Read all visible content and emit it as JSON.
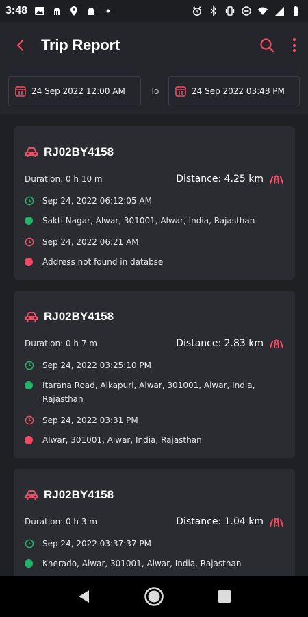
{
  "statusbar": {
    "time": "3:48"
  },
  "header": {
    "title": "Trip Report"
  },
  "filters": {
    "from_date": "24 Sep 2022 12:00 AM",
    "to_label": "To",
    "to_date": "24 Sep 2022 03:48 PM"
  },
  "colors": {
    "accent": "#f04b64",
    "start": "#24b36b",
    "background": "#1e2024",
    "card": "#2a2c31"
  },
  "trips": [
    {
      "vehicle": "RJ02BY4158",
      "duration": "Duration: 0 h 10 m",
      "distance": "Distance: 4.25 km",
      "start_time": "Sep 24, 2022 06:12:05 AM",
      "start_address": "Sakti Nagar, Alwar, 301001, Alwar, India, Rajasthan",
      "end_time": "Sep 24, 2022 06:21 AM",
      "end_address": "Address not found in databse"
    },
    {
      "vehicle": "RJ02BY4158",
      "duration": "Duration: 0 h 7 m",
      "distance": "Distance: 2.83 km",
      "start_time": "Sep 24, 2022 03:25:10 PM",
      "start_address": "Itarana Road, Alkapuri, Alwar, 301001, Alwar, India, Rajasthan",
      "end_time": "Sep 24, 2022 03:31 PM",
      "end_address": "Alwar, 301001, Alwar, India, Rajasthan"
    },
    {
      "vehicle": "RJ02BY4158",
      "duration": "Duration: 0 h 3 m",
      "distance": "Distance: 1.04 km",
      "start_time": "Sep 24, 2022 03:37:37 PM",
      "start_address": "Kherado, Alwar, 301001, Alwar, India, Rajasthan",
      "end_time": "",
      "end_address": ""
    }
  ]
}
